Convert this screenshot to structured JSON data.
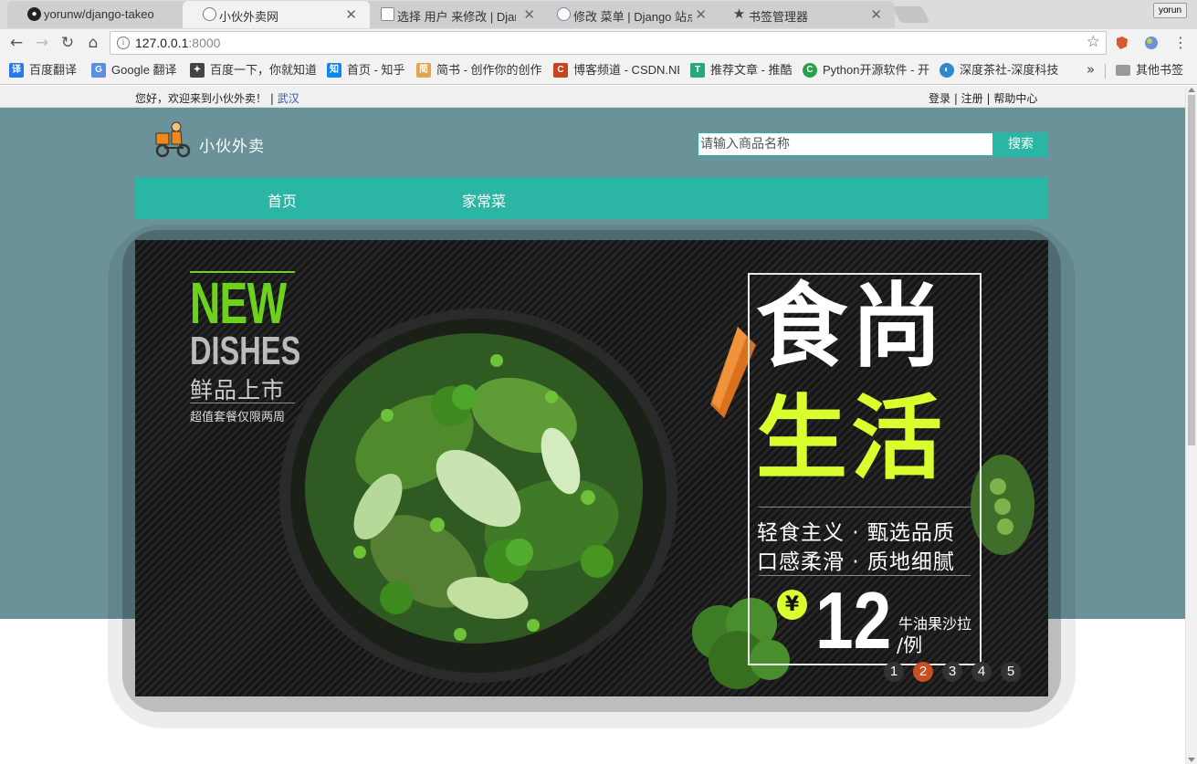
{
  "browser": {
    "tabs": [
      {
        "title": "yorunw/django-takeo",
        "icon": "github-icon"
      },
      {
        "title": "小伙外卖网",
        "icon": "page-icon"
      },
      {
        "title": "选择 用户 来修改 | Djan",
        "icon": "document-icon"
      },
      {
        "title": "修改 菜单 | Django 站点",
        "icon": "page-icon"
      },
      {
        "title": "书签管理器",
        "icon": "star-icon"
      }
    ],
    "profile_name": "yorun",
    "url_host": "127.0.0.1",
    "url_port": ":8000",
    "bookmarks": [
      {
        "label": "百度翻译",
        "icon_text": "译",
        "color": "#2a79e4"
      },
      {
        "label": "Google 翻译",
        "icon_text": "G",
        "color": "#5b8fe0"
      },
      {
        "label": "百度一下，你就知道",
        "icon_text": "✦",
        "color": "#444444"
      },
      {
        "label": "首页 - 知乎",
        "icon_text": "知",
        "color": "#0f88eb"
      },
      {
        "label": "简书 - 创作你的创作",
        "icon_text": "简",
        "color": "#e3a54a"
      },
      {
        "label": "博客频道 - CSDN.NET",
        "icon_text": "C",
        "color": "#c9431f"
      },
      {
        "label": "推荐文章 - 推酷",
        "icon_text": "T",
        "color": "#27a87d"
      },
      {
        "label": "Python开源软件 - 开",
        "icon_text": "C",
        "color": "#2aa04a"
      },
      {
        "label": "深度茶社-深度科技",
        "icon_text": "◐",
        "color": "#2d88d0"
      }
    ],
    "more_bookmarks": "»",
    "other_bookmarks": "其他书签"
  },
  "site": {
    "welcome": "您好，欢迎来到小伙外卖！",
    "city_sep": "|",
    "city": "武汉",
    "links": "登录 |   注册 |   帮助中心",
    "brand": "小伙外卖",
    "search_placeholder": "请输入商品名称",
    "search_button": "搜索",
    "nav": [
      "首页",
      "家常菜"
    ],
    "banner": {
      "new": "NEW",
      "dishes": "DISHES",
      "fresh": "鲜品上市",
      "combo": "超值套餐仅限两周",
      "headline1": "食尚",
      "headline2": "生活",
      "tagline1": "轻食主义 · 甄选品质",
      "tagline2": "口感柔滑 · 质地细腻",
      "currency": "¥",
      "price": "12",
      "product": "牛油果沙拉",
      "unit": "/例"
    },
    "carousel_pages": [
      "1",
      "2",
      "3",
      "4",
      "5"
    ],
    "carousel_active": 2,
    "colors": {
      "teal": "#2ab5a5",
      "slate": "#6b9199",
      "accent_green": "#d9ff2e",
      "active_dot": "#c94f20"
    }
  }
}
